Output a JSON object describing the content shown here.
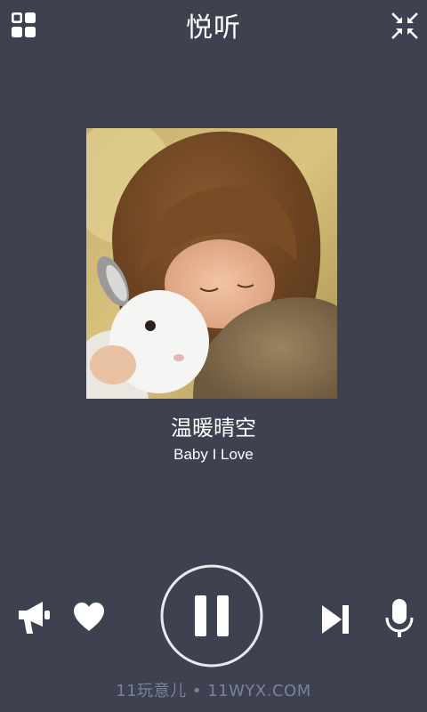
{
  "header": {
    "title": "悦听",
    "menu_icon": "grid-icon",
    "collapse_icon": "collapse-arrows-icon"
  },
  "now_playing": {
    "song_title": "温暖晴空",
    "artist": "Baby I Love",
    "cover_description_icon": "album-cover"
  },
  "controls": {
    "speaker_icon": "megaphone-icon",
    "favorite_icon": "heart-icon",
    "play_pause_icon": "pause-icon",
    "next_icon": "skip-next-icon",
    "mic_icon": "microphone-icon"
  },
  "watermark": "11玩意儿 • 11WYX.COM",
  "colors": {
    "background": "#3e4150",
    "foreground": "#ffffff",
    "watermark": "#7a8296"
  }
}
